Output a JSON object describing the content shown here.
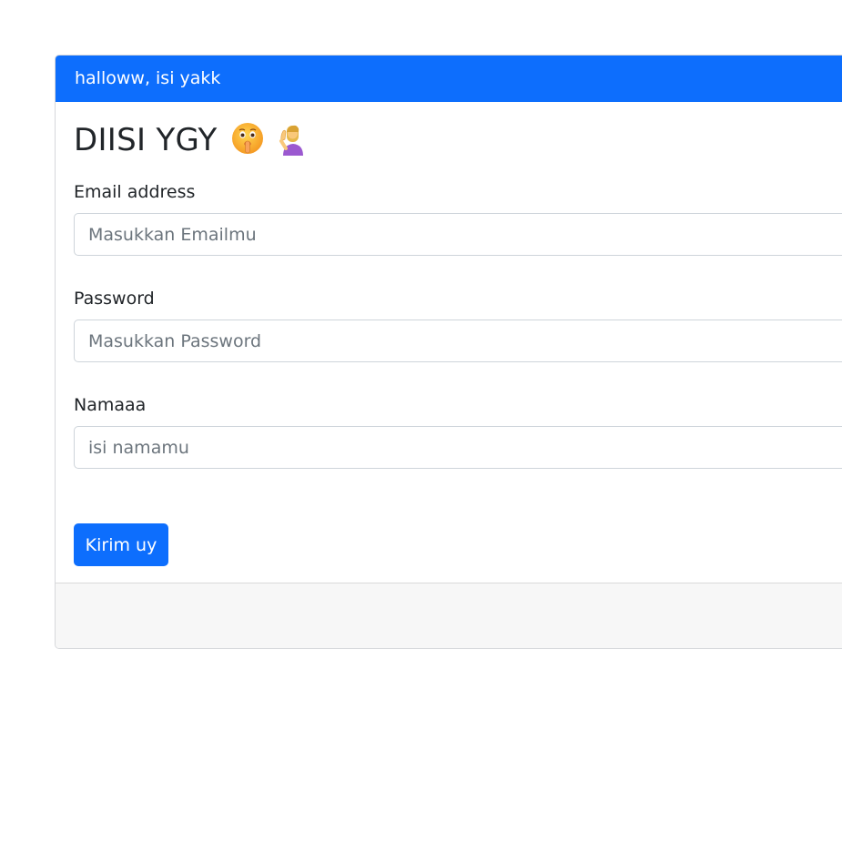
{
  "card": {
    "header_text": "halloww, isi yakk",
    "title": "DIISI YGY",
    "title_emojis": [
      "shushing-face-emoji",
      "woman-tipping-hand-emoji"
    ]
  },
  "form": {
    "email": {
      "label": "Email address",
      "placeholder": "Masukkan Emailmu",
      "value": ""
    },
    "password": {
      "label": "Password",
      "placeholder": "Masukkan Password",
      "value": ""
    },
    "name": {
      "label": "Namaaa",
      "placeholder": "isi namamu",
      "value": ""
    },
    "submit_label": "Kirim uy"
  },
  "colors": {
    "primary": "#0d6efd",
    "footer_bg": "#f7f7f7",
    "placeholder": "#6c757d"
  }
}
